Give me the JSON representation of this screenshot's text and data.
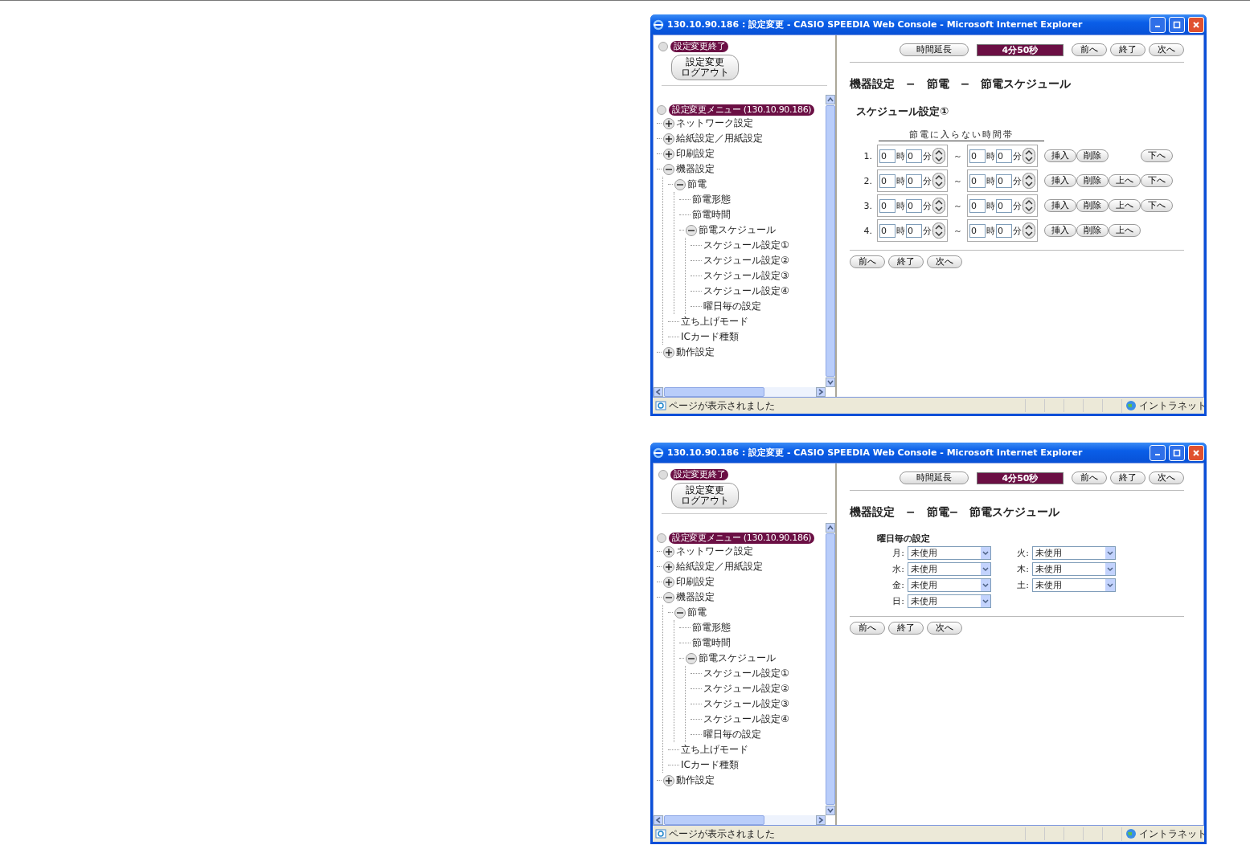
{
  "windows": [
    {
      "title": "130.10.90.186 : 設定変更 - CASIO SPEEDIA Web Console - Microsoft Internet Explorer",
      "sidebar": {
        "end_label": "設定変更終了",
        "logout_lines": [
          "設定変更",
          "ログアウト"
        ],
        "menu_label": "設定変更メニュー (130.10.90.186)",
        "tree": [
          {
            "label": "ネットワーク設定",
            "expanded": false
          },
          {
            "label": "給紙設定／用紙設定",
            "expanded": false
          },
          {
            "label": "印刷設定",
            "expanded": false
          },
          {
            "label": "機器設定",
            "expanded": true,
            "children": [
              {
                "label": "節電",
                "expanded": true,
                "children": [
                  {
                    "label": "節電形態"
                  },
                  {
                    "label": "節電時間"
                  },
                  {
                    "label": "節電スケジュール",
                    "expanded": true,
                    "children": [
                      {
                        "label": "スケジュール設定①"
                      },
                      {
                        "label": "スケジュール設定②"
                      },
                      {
                        "label": "スケジュール設定③"
                      },
                      {
                        "label": "スケジュール設定④"
                      },
                      {
                        "label": "曜日毎の設定"
                      }
                    ]
                  }
                ]
              },
              {
                "label": "立ち上げモード"
              },
              {
                "label": "ICカード種類"
              }
            ]
          },
          {
            "label": "動作設定",
            "expanded": false
          }
        ]
      },
      "content": {
        "extend_button": "時間延長",
        "timer": "4分50秒",
        "nav_buttons": [
          "前へ",
          "終了",
          "次へ"
        ],
        "heading": "機器設定　−　節電　−　節電スケジュール",
        "panel": {
          "kind": "schedule",
          "title": "スケジュール設定①",
          "column_header": "節電に入らない時間帯",
          "rows": [
            {
              "number": "1.",
              "from": {
                "hour": "0",
                "hour_unit": "時",
                "minute": "0",
                "minute_unit": "分"
              },
              "tilde": "～",
              "to": {
                "hour": "0",
                "hour_unit": "時",
                "minute": "0",
                "minute_unit": "分"
              },
              "buttons": [
                {
                  "kind": "insert",
                  "label": "挿入"
                },
                {
                  "kind": "delete",
                  "label": "削除"
                },
                {
                  "kind": "down",
                  "label": "下へ"
                }
              ]
            },
            {
              "number": "2.",
              "from": {
                "hour": "0",
                "hour_unit": "時",
                "minute": "0",
                "minute_unit": "分"
              },
              "tilde": "～",
              "to": {
                "hour": "0",
                "hour_unit": "時",
                "minute": "0",
                "minute_unit": "分"
              },
              "buttons": [
                {
                  "kind": "insert",
                  "label": "挿入"
                },
                {
                  "kind": "delete",
                  "label": "削除"
                },
                {
                  "kind": "up",
                  "label": "上へ"
                },
                {
                  "kind": "down",
                  "label": "下へ"
                }
              ]
            },
            {
              "number": "3.",
              "from": {
                "hour": "0",
                "hour_unit": "時",
                "minute": "0",
                "minute_unit": "分"
              },
              "tilde": "～",
              "to": {
                "hour": "0",
                "hour_unit": "時",
                "minute": "0",
                "minute_unit": "分"
              },
              "buttons": [
                {
                  "kind": "insert",
                  "label": "挿入"
                },
                {
                  "kind": "delete",
                  "label": "削除"
                },
                {
                  "kind": "up",
                  "label": "上へ"
                },
                {
                  "kind": "down",
                  "label": "下へ"
                }
              ]
            },
            {
              "number": "4.",
              "from": {
                "hour": "0",
                "hour_unit": "時",
                "minute": "0",
                "minute_unit": "分"
              },
              "tilde": "～",
              "to": {
                "hour": "0",
                "hour_unit": "時",
                "minute": "0",
                "minute_unit": "分"
              },
              "buttons": [
                {
                  "kind": "insert",
                  "label": "挿入"
                },
                {
                  "kind": "delete",
                  "label": "削除"
                },
                {
                  "kind": "up",
                  "label": "上へ"
                }
              ]
            }
          ]
        },
        "bottom_buttons": [
          "前へ",
          "終了",
          "次へ"
        ]
      },
      "status_bar": {
        "text": "ページが表示されました",
        "zone": "イントラネット"
      }
    },
    {
      "title": "130.10.90.186 : 設定変更 - CASIO SPEEDIA Web Console - Microsoft Internet Explorer",
      "sidebar": {
        "end_label": "設定変更終了",
        "logout_lines": [
          "設定変更",
          "ログアウト"
        ],
        "menu_label": "設定変更メニュー (130.10.90.186)",
        "tree": [
          {
            "label": "ネットワーク設定",
            "expanded": false
          },
          {
            "label": "給紙設定／用紙設定",
            "expanded": false
          },
          {
            "label": "印刷設定",
            "expanded": false
          },
          {
            "label": "機器設定",
            "expanded": true,
            "children": [
              {
                "label": "節電",
                "expanded": true,
                "children": [
                  {
                    "label": "節電形態"
                  },
                  {
                    "label": "節電時間"
                  },
                  {
                    "label": "節電スケジュール",
                    "expanded": true,
                    "children": [
                      {
                        "label": "スケジュール設定①"
                      },
                      {
                        "label": "スケジュール設定②"
                      },
                      {
                        "label": "スケジュール設定③"
                      },
                      {
                        "label": "スケジュール設定④"
                      },
                      {
                        "label": "曜日毎の設定"
                      }
                    ]
                  }
                ]
              },
              {
                "label": "立ち上げモード"
              },
              {
                "label": "ICカード種類"
              }
            ]
          },
          {
            "label": "動作設定",
            "expanded": false
          }
        ]
      },
      "content": {
        "extend_button": "時間延長",
        "timer": "4分50秒",
        "nav_buttons": [
          "前へ",
          "終了",
          "次へ"
        ],
        "heading": "機器設定　−　節電−　節電スケジュール",
        "panel": {
          "kind": "weekday",
          "title": "曜日毎の設定",
          "days": [
            {
              "label": "月:",
              "value": "未使用"
            },
            {
              "label": "火:",
              "value": "未使用"
            },
            {
              "label": "水:",
              "value": "未使用"
            },
            {
              "label": "木:",
              "value": "未使用"
            },
            {
              "label": "金:",
              "value": "未使用"
            },
            {
              "label": "土:",
              "value": "未使用"
            },
            {
              "label": "日:",
              "value": "未使用"
            }
          ]
        },
        "bottom_buttons": [
          "前へ",
          "終了",
          "次へ"
        ]
      },
      "status_bar": {
        "text": "ページが表示されました",
        "zone": "イントラネット"
      }
    }
  ]
}
